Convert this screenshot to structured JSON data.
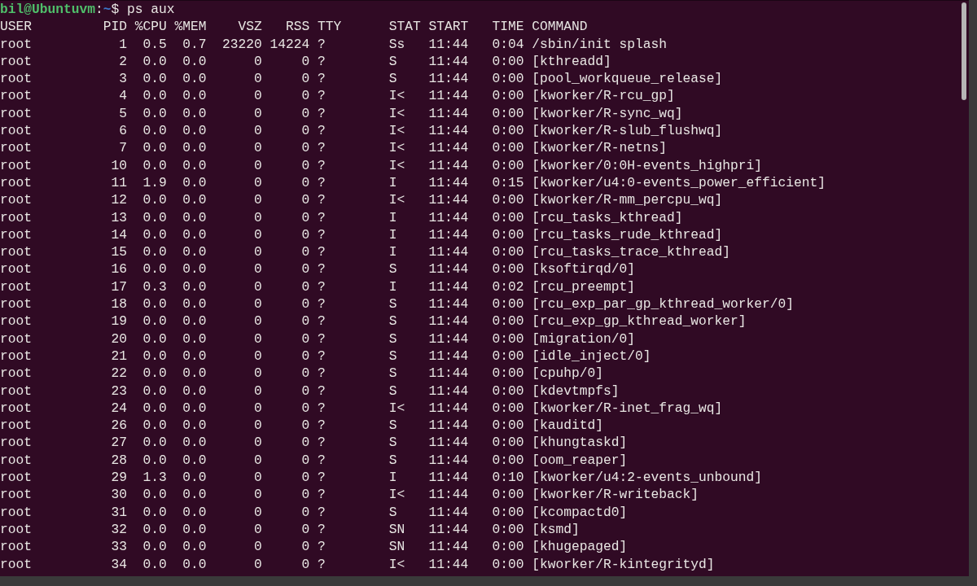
{
  "prompt": {
    "user_host": "bil@Ubuntuvm",
    "separator": ":",
    "path": "~",
    "symbol": "$",
    "command": "ps aux"
  },
  "table": {
    "columns": [
      "USER",
      "PID",
      "%CPU",
      "%MEM",
      "VSZ",
      "RSS",
      "TTY",
      "STAT",
      "START",
      "TIME",
      "COMMAND"
    ],
    "rows": [
      [
        "root",
        "1",
        "0.5",
        "0.7",
        "23220",
        "14224",
        "?",
        "Ss",
        "11:44",
        "0:04",
        "/sbin/init splash"
      ],
      [
        "root",
        "2",
        "0.0",
        "0.0",
        "0",
        "0",
        "?",
        "S",
        "11:44",
        "0:00",
        "[kthreadd]"
      ],
      [
        "root",
        "3",
        "0.0",
        "0.0",
        "0",
        "0",
        "?",
        "S",
        "11:44",
        "0:00",
        "[pool_workqueue_release]"
      ],
      [
        "root",
        "4",
        "0.0",
        "0.0",
        "0",
        "0",
        "?",
        "I<",
        "11:44",
        "0:00",
        "[kworker/R-rcu_gp]"
      ],
      [
        "root",
        "5",
        "0.0",
        "0.0",
        "0",
        "0",
        "?",
        "I<",
        "11:44",
        "0:00",
        "[kworker/R-sync_wq]"
      ],
      [
        "root",
        "6",
        "0.0",
        "0.0",
        "0",
        "0",
        "?",
        "I<",
        "11:44",
        "0:00",
        "[kworker/R-slub_flushwq]"
      ],
      [
        "root",
        "7",
        "0.0",
        "0.0",
        "0",
        "0",
        "?",
        "I<",
        "11:44",
        "0:00",
        "[kworker/R-netns]"
      ],
      [
        "root",
        "10",
        "0.0",
        "0.0",
        "0",
        "0",
        "?",
        "I<",
        "11:44",
        "0:00",
        "[kworker/0:0H-events_highpri]"
      ],
      [
        "root",
        "11",
        "1.9",
        "0.0",
        "0",
        "0",
        "?",
        "I",
        "11:44",
        "0:15",
        "[kworker/u4:0-events_power_efficient]"
      ],
      [
        "root",
        "12",
        "0.0",
        "0.0",
        "0",
        "0",
        "?",
        "I<",
        "11:44",
        "0:00",
        "[kworker/R-mm_percpu_wq]"
      ],
      [
        "root",
        "13",
        "0.0",
        "0.0",
        "0",
        "0",
        "?",
        "I",
        "11:44",
        "0:00",
        "[rcu_tasks_kthread]"
      ],
      [
        "root",
        "14",
        "0.0",
        "0.0",
        "0",
        "0",
        "?",
        "I",
        "11:44",
        "0:00",
        "[rcu_tasks_rude_kthread]"
      ],
      [
        "root",
        "15",
        "0.0",
        "0.0",
        "0",
        "0",
        "?",
        "I",
        "11:44",
        "0:00",
        "[rcu_tasks_trace_kthread]"
      ],
      [
        "root",
        "16",
        "0.0",
        "0.0",
        "0",
        "0",
        "?",
        "S",
        "11:44",
        "0:00",
        "[ksoftirqd/0]"
      ],
      [
        "root",
        "17",
        "0.3",
        "0.0",
        "0",
        "0",
        "?",
        "I",
        "11:44",
        "0:02",
        "[rcu_preempt]"
      ],
      [
        "root",
        "18",
        "0.0",
        "0.0",
        "0",
        "0",
        "?",
        "S",
        "11:44",
        "0:00",
        "[rcu_exp_par_gp_kthread_worker/0]"
      ],
      [
        "root",
        "19",
        "0.0",
        "0.0",
        "0",
        "0",
        "?",
        "S",
        "11:44",
        "0:00",
        "[rcu_exp_gp_kthread_worker]"
      ],
      [
        "root",
        "20",
        "0.0",
        "0.0",
        "0",
        "0",
        "?",
        "S",
        "11:44",
        "0:00",
        "[migration/0]"
      ],
      [
        "root",
        "21",
        "0.0",
        "0.0",
        "0",
        "0",
        "?",
        "S",
        "11:44",
        "0:00",
        "[idle_inject/0]"
      ],
      [
        "root",
        "22",
        "0.0",
        "0.0",
        "0",
        "0",
        "?",
        "S",
        "11:44",
        "0:00",
        "[cpuhp/0]"
      ],
      [
        "root",
        "23",
        "0.0",
        "0.0",
        "0",
        "0",
        "?",
        "S",
        "11:44",
        "0:00",
        "[kdevtmpfs]"
      ],
      [
        "root",
        "24",
        "0.0",
        "0.0",
        "0",
        "0",
        "?",
        "I<",
        "11:44",
        "0:00",
        "[kworker/R-inet_frag_wq]"
      ],
      [
        "root",
        "26",
        "0.0",
        "0.0",
        "0",
        "0",
        "?",
        "S",
        "11:44",
        "0:00",
        "[kauditd]"
      ],
      [
        "root",
        "27",
        "0.0",
        "0.0",
        "0",
        "0",
        "?",
        "S",
        "11:44",
        "0:00",
        "[khungtaskd]"
      ],
      [
        "root",
        "28",
        "0.0",
        "0.0",
        "0",
        "0",
        "?",
        "S",
        "11:44",
        "0:00",
        "[oom_reaper]"
      ],
      [
        "root",
        "29",
        "1.3",
        "0.0",
        "0",
        "0",
        "?",
        "I",
        "11:44",
        "0:10",
        "[kworker/u4:2-events_unbound]"
      ],
      [
        "root",
        "30",
        "0.0",
        "0.0",
        "0",
        "0",
        "?",
        "I<",
        "11:44",
        "0:00",
        "[kworker/R-writeback]"
      ],
      [
        "root",
        "31",
        "0.0",
        "0.0",
        "0",
        "0",
        "?",
        "S",
        "11:44",
        "0:00",
        "[kcompactd0]"
      ],
      [
        "root",
        "32",
        "0.0",
        "0.0",
        "0",
        "0",
        "?",
        "SN",
        "11:44",
        "0:00",
        "[ksmd]"
      ],
      [
        "root",
        "33",
        "0.0",
        "0.0",
        "0",
        "0",
        "?",
        "SN",
        "11:44",
        "0:00",
        "[khugepaged]"
      ],
      [
        "root",
        "34",
        "0.0",
        "0.0",
        "0",
        "0",
        "?",
        "I<",
        "11:44",
        "0:00",
        "[kworker/R-kintegrityd]"
      ]
    ]
  }
}
